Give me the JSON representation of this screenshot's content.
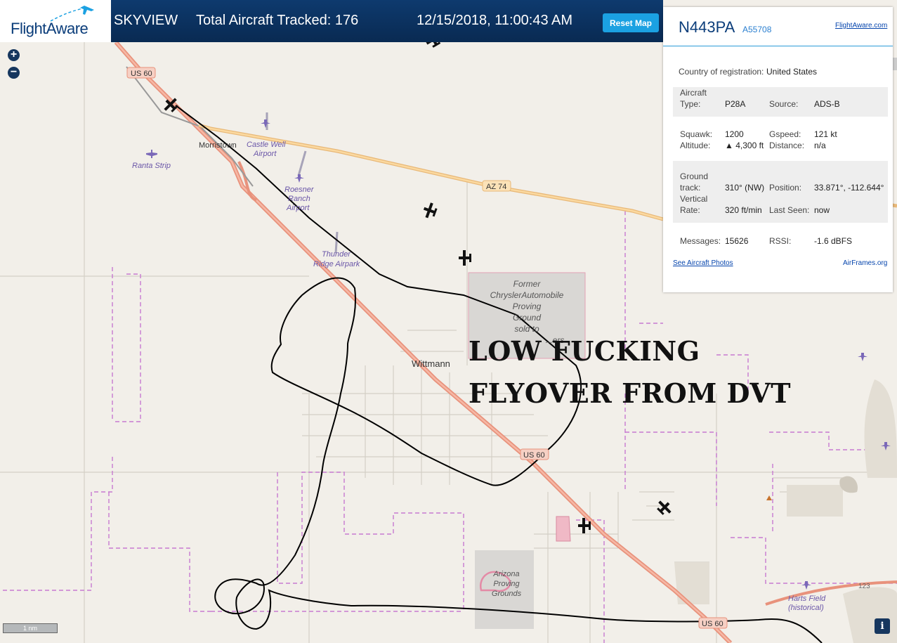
{
  "header": {
    "brand": "FlightAware",
    "app_name": "SKYVIEW",
    "aircraft_tracked": "Total Aircraft Tracked: 176",
    "datetime": "12/15/2018, 11:00:43 AM",
    "reset_label": "Reset Map"
  },
  "map_controls": {
    "zoom_in": "+",
    "zoom_out": "−",
    "scale": "1 nm",
    "info": "i"
  },
  "map_labels": {
    "us60_top": "US 60",
    "us60_mid": "US 60",
    "us60_bottom": "US 60",
    "az74": "AZ 74",
    "hwy123": "123",
    "morristown": "Morristown",
    "wittmann": "Wittmann",
    "castle_well_1": "Castle Well",
    "castle_well_2": "Airport",
    "ranta": "Ranta Strip",
    "roesner_1": "Roesner",
    "roesner_2": "Ranch",
    "roesner_3": "Airport",
    "thunder_1": "Thunder",
    "thunder_2": "Ridge Airpark",
    "chrysler_1": "Former",
    "chrysler_2": "ChryslerAutomobile",
    "chrysler_3": "Proving",
    "chrysler_4": "Ground",
    "chrysler_5": "sold to",
    "chrysler_6": "...ers",
    "arizona_1": "Arizona",
    "arizona_2": "Proving",
    "arizona_3": "Grounds",
    "harts_1": "Harts Field",
    "harts_2": "(historical)"
  },
  "caption": {
    "line1": "LOW FUCKING",
    "line2": "FLYOVER FROM DVT"
  },
  "panel": {
    "registration": "N443PA",
    "hex": "A55708",
    "fa_link": "FlightAware.com",
    "country_label": "Country of registration:",
    "country": "United States",
    "aircraft_type_label_1": "Aircraft",
    "aircraft_type_label_2": "Type:",
    "aircraft_type": "P28A",
    "source_label": "Source:",
    "source": "ADS-B",
    "squawk_label": "Squawk:",
    "squawk": "1200",
    "gspeed_label": "Gspeed:",
    "gspeed": "121 kt",
    "altitude_label": "Altitude:",
    "altitude": "▲ 4,300 ft",
    "distance_label": "Distance:",
    "distance": "n/a",
    "ground_label_1": "Ground",
    "ground_label_2": "track:",
    "ground_track": "310° (NW)",
    "position_label": "Position:",
    "position": "33.871°, -112.644°",
    "vertical_label_1": "Vertical",
    "vertical_label_2": "Rate:",
    "vertical_rate": "320 ft/min",
    "last_seen_label": "Last Seen:",
    "last_seen": "now",
    "messages_label": "Messages:",
    "messages": "15626",
    "rssi_label": "RSSI:",
    "rssi": "-1.6 dBFS",
    "photos_link": "See Aircraft Photos",
    "airframes_link": "AirFrames.org"
  },
  "colors": {
    "header_bg": "#0b3162",
    "accent": "#1ba1e2",
    "highway": "#e8927c",
    "state_route": "#f4c27a",
    "boundary": "#c77ad1",
    "track": "#000000"
  }
}
